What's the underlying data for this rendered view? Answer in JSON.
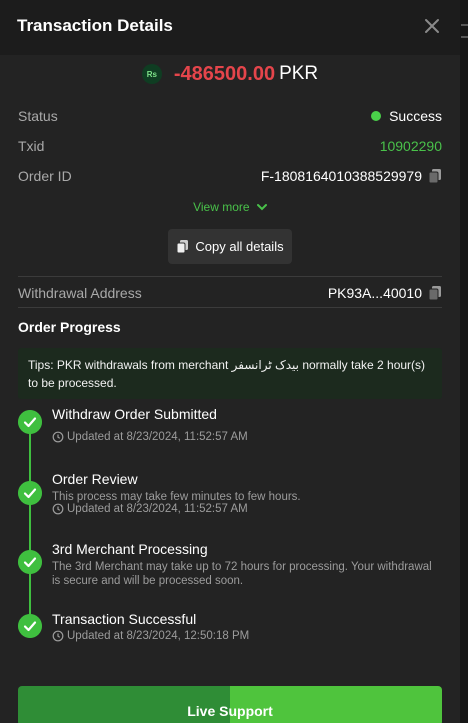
{
  "header": {
    "title": "Transaction Details"
  },
  "amount": {
    "badge": "Rs",
    "value": "-486500.00",
    "currency": "PKR"
  },
  "details": {
    "status_label": "Status",
    "status_value": "Success",
    "txid_label": "Txid",
    "txid_value": "10902290",
    "order_id_label": "Order ID",
    "order_id_value": "F-1808164010388529979"
  },
  "view_more": "View more",
  "copy_all": "Copy all details",
  "withdrawal": {
    "label": "Withdrawal Address",
    "value": "PK93A...40010"
  },
  "progress": {
    "title": "Order Progress",
    "tips": "Tips: PKR withdrawals from merchant بیدک ٹرانسفر normally take 2 hour(s) to be processed.",
    "steps": [
      {
        "title": "Withdraw Order Submitted",
        "desc": "",
        "time": "Updated at 8/23/2024, 11:52:57 AM"
      },
      {
        "title": "Order Review",
        "desc": "This process may take few minutes to few hours.",
        "time": "Updated at 8/23/2024, 11:52:57 AM"
      },
      {
        "title": "3rd Merchant Processing",
        "desc": "The 3rd Merchant may take up to 72 hours for processing. Your withdrawal is secure and will be processed soon.",
        "time": ""
      },
      {
        "title": "Transaction Successful",
        "desc": "",
        "time": "Updated at 8/23/2024, 12:50:18 PM"
      }
    ]
  },
  "live_support": "Live Support",
  "colors": {
    "accent_green": "#49c14a",
    "amount_red": "#e5454b",
    "background": "#232323"
  }
}
